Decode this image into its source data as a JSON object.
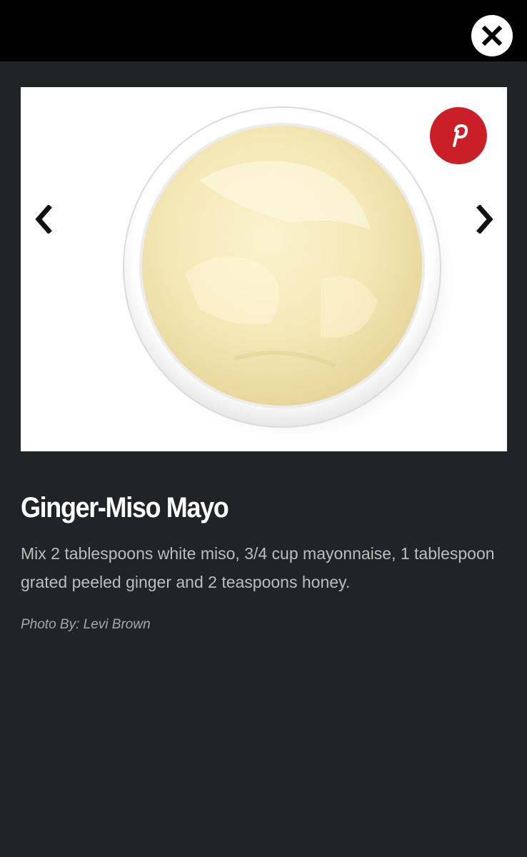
{
  "modal": {
    "close_label": "close",
    "close_icon": "close-x-icon"
  },
  "gallery": {
    "image_description_icon": "photo-image",
    "prev_icon": "chevron-left-icon",
    "next_icon": "chevron-right-icon",
    "pinterest_icon": "pinterest-icon"
  },
  "slide": {
    "title": "Ginger-Miso Mayo",
    "description": "Mix 2 tablespoons white miso, 3/4 cup mayonnaise, 1 tablespoon grated peeled ginger and 2 teaspoons honey.",
    "credit": "Photo By: Levi Brown"
  },
  "colors": {
    "background": "#222324",
    "topbar": "#000000",
    "pinterest": "#cb1f27",
    "title": "#ffffff",
    "body_text": "#bdbdbd"
  }
}
